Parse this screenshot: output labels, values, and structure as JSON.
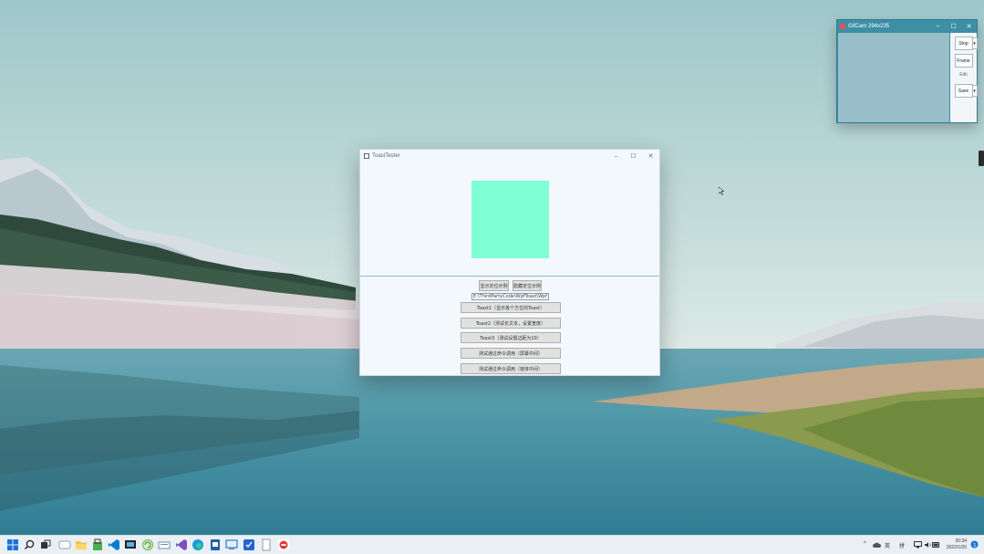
{
  "toast_window": {
    "title": "ToastTester",
    "min": "–",
    "max": "☐",
    "close": "✕",
    "buttons": {
      "show_demo": "显示定位示例",
      "hide_demo": "隐藏定位示例",
      "toast1": "Toast1（显示各个方位的Toast）",
      "toast2": "Toast2（测试长文本，设置宽度）",
      "toast3": "Toast3（测试设置边距为10）",
      "cmd_screen": "测试通过命令调用（屏幕中间）",
      "cmd_window": "测试通过命令调用（窗体中间）"
    },
    "path": "E:\\ThirdPartyCode\\WpfToast\\Wpf"
  },
  "gifcam": {
    "title": "GifCam 294x235",
    "min": "–",
    "max": "☐",
    "close": "✕",
    "stop": "Stop",
    "frame": "Frame",
    "edit": "Edit",
    "save": "Save",
    "dropdown": "▾",
    "size_label": "- - -"
  },
  "taskbar": {
    "tray_lang": "英",
    "tray_ime": "拼",
    "time": "20:34",
    "date": "2022/1/20"
  },
  "colors": {
    "accent_square": "#7fffd4",
    "taskbar_bg": "#e9eff3",
    "gifcam_title": "#3d8fa6"
  }
}
